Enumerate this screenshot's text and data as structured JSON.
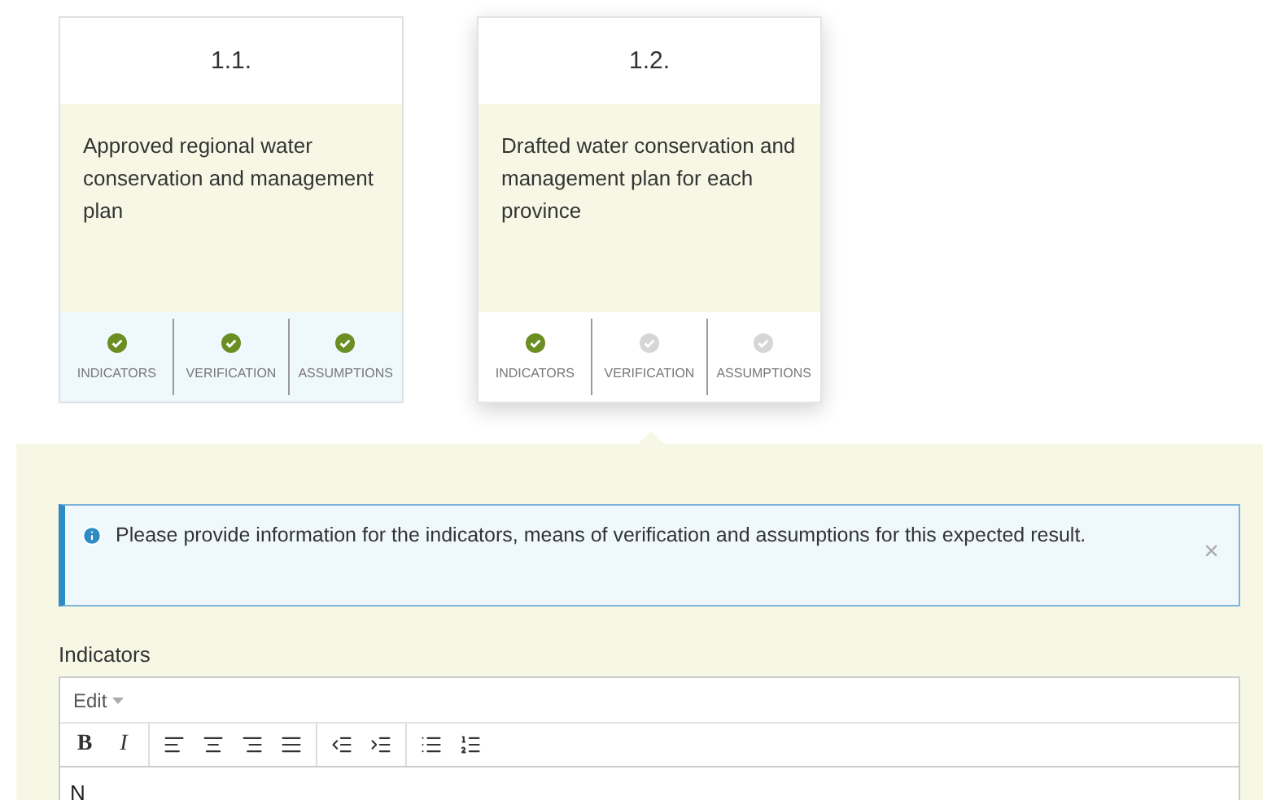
{
  "cards": [
    {
      "number": "1.1.",
      "text": "Approved regional water conservation and management plan",
      "selected": false,
      "checks": [
        {
          "label": "INDICATORS",
          "done": true
        },
        {
          "label": "VERIFICATION",
          "done": true
        },
        {
          "label": "ASSUMPTIONS",
          "done": true
        }
      ]
    },
    {
      "number": "1.2.",
      "text": "Drafted water conservation and management plan for each province",
      "selected": true,
      "checks": [
        {
          "label": "INDICATORS",
          "done": true
        },
        {
          "label": "VERIFICATION",
          "done": false
        },
        {
          "label": "ASSUMPTIONS",
          "done": false
        }
      ]
    }
  ],
  "alert": {
    "message": "Please provide information for the indicators, means of verification and assumptions for this expected result.",
    "close": "×"
  },
  "editor": {
    "label": "Indicators",
    "menu": [
      "Edit"
    ],
    "toolbar": [
      [
        {
          "kind": "bold",
          "label": "B"
        },
        {
          "kind": "italic",
          "label": "I"
        }
      ],
      [
        {
          "kind": "align-left"
        },
        {
          "kind": "align-center"
        },
        {
          "kind": "align-right"
        },
        {
          "kind": "align-justify"
        }
      ],
      [
        {
          "kind": "outdent"
        },
        {
          "kind": "indent"
        }
      ],
      [
        {
          "kind": "bullets"
        },
        {
          "kind": "numbers"
        }
      ]
    ],
    "content": "N"
  }
}
